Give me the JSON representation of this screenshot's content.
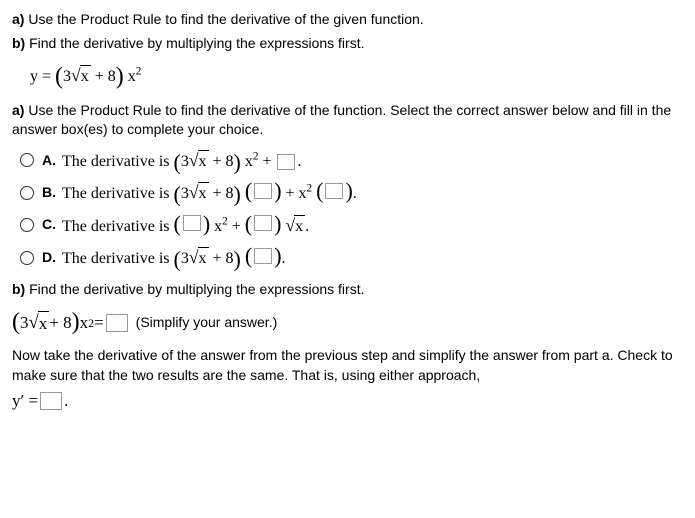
{
  "intro": {
    "a_label": "a)",
    "a_text": " Use the Product Rule to find the derivative of the given function.",
    "b_label": "b)",
    "b_text": " Find the derivative by multiplying the expressions first."
  },
  "equation": {
    "lhs": "y = ",
    "lp": "(",
    "coef": "3",
    "sqrt_sym": "√",
    "radicand": "x",
    "plus8": " + 8",
    "rp": ")",
    "xsq": " x",
    "sq": "2"
  },
  "partA": {
    "label": "a)",
    "text": " Use the Product Rule to find the derivative of the function. Select the correct answer below and fill in the answer box(es) to complete your choice."
  },
  "choices": {
    "A": {
      "letter": "A.",
      "lead": "The derivative is ",
      "plus": " + ",
      "period": "."
    },
    "B": {
      "letter": "B.",
      "lead": "The derivative is ",
      "plusx2": " + x",
      "sq": "2",
      "period": "."
    },
    "C": {
      "letter": "C.",
      "lead": "The derivative is ",
      "xsq": " x",
      "sq": "2",
      "plus": " + ",
      "sqrt": "x",
      "period": "."
    },
    "D": {
      "letter": "D.",
      "lead": "The derivative is ",
      "period": "."
    }
  },
  "partB": {
    "label": "b)",
    "text": " Find the derivative by multiplying the expressions first."
  },
  "eqn2": {
    "eq": " = ",
    "help": "(Simplify your answer.)"
  },
  "final": {
    "text1": "Now take the derivative of the answer from the previous step and simplify the answer from part a.  Check to make sure that the two results are the same. That is, using either approach,",
    "yprime": "y′ = ",
    "period": "."
  }
}
